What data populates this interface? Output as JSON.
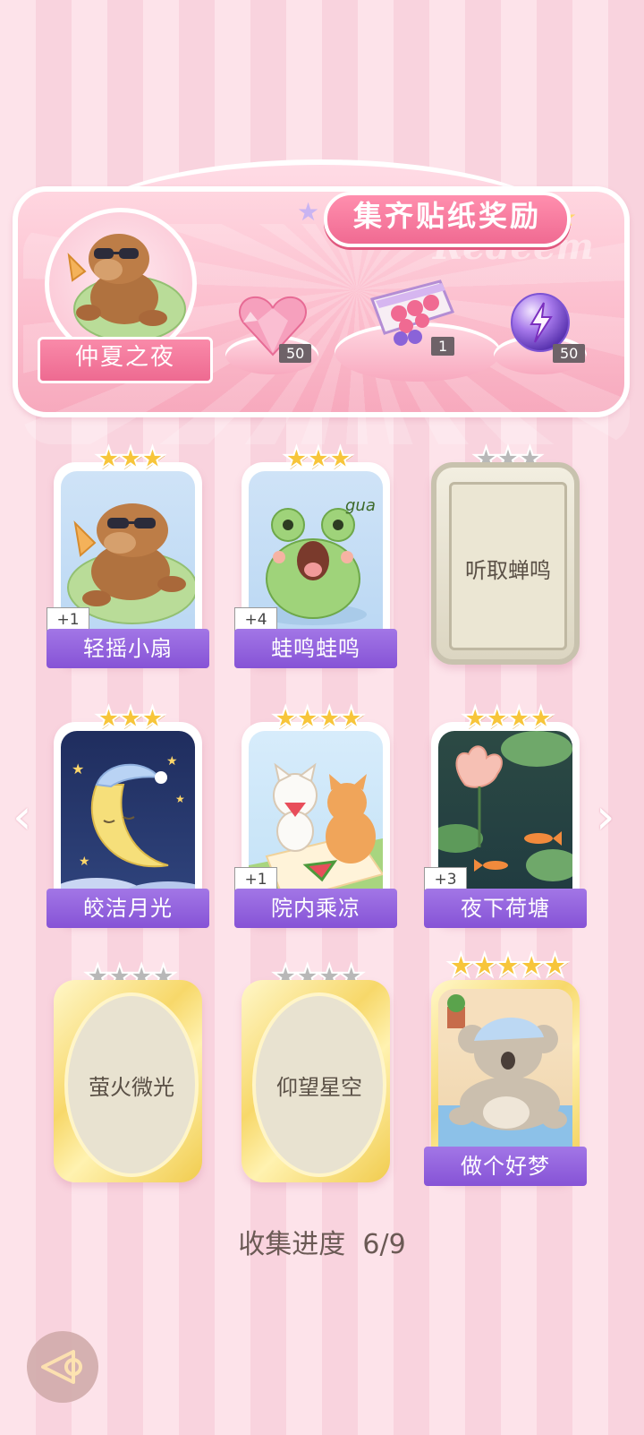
{
  "banner": {
    "title": "集齐贴纸奖励",
    "watermark": "Redeem",
    "theme_name": "仲夏之夜",
    "rewards": [
      {
        "icon": "pink-heart-gem-icon",
        "count": "50"
      },
      {
        "icon": "gift-box-icon",
        "count": "1"
      },
      {
        "icon": "purple-energy-orb-icon",
        "count": "50"
      }
    ]
  },
  "cards": [
    {
      "name": "轻摇小扇",
      "stars": 3,
      "star_total": 3,
      "count": "+1",
      "unlocked": true,
      "frame": "normal"
    },
    {
      "name": "蛙鸣蛙鸣",
      "stars": 3,
      "star_total": 3,
      "count": "+4",
      "unlocked": true,
      "frame": "normal",
      "art_text": "gua"
    },
    {
      "name": "听取蝉鸣",
      "stars": 0,
      "star_total": 3,
      "count": "",
      "unlocked": false,
      "frame": "normal"
    },
    {
      "name": "皎洁月光",
      "stars": 3,
      "star_total": 3,
      "count": "",
      "unlocked": true,
      "frame": "normal"
    },
    {
      "name": "院内乘凉",
      "stars": 4,
      "star_total": 4,
      "count": "+1",
      "unlocked": true,
      "frame": "normal"
    },
    {
      "name": "夜下荷塘",
      "stars": 4,
      "star_total": 4,
      "count": "+3",
      "unlocked": true,
      "frame": "normal"
    },
    {
      "name": "萤火微光",
      "stars": 0,
      "star_total": 4,
      "count": "",
      "unlocked": false,
      "frame": "gold"
    },
    {
      "name": "仰望星空",
      "stars": 0,
      "star_total": 4,
      "count": "",
      "unlocked": false,
      "frame": "gold"
    },
    {
      "name": "做个好梦",
      "stars": 5,
      "star_total": 5,
      "count": "",
      "unlocked": true,
      "frame": "gold"
    }
  ],
  "progress": {
    "label": "收集进度",
    "value": "6/9"
  },
  "colors": {
    "accent_pink": "#f06a92",
    "label_purple": "#8653d6",
    "star_gold": "#f7c53a"
  }
}
